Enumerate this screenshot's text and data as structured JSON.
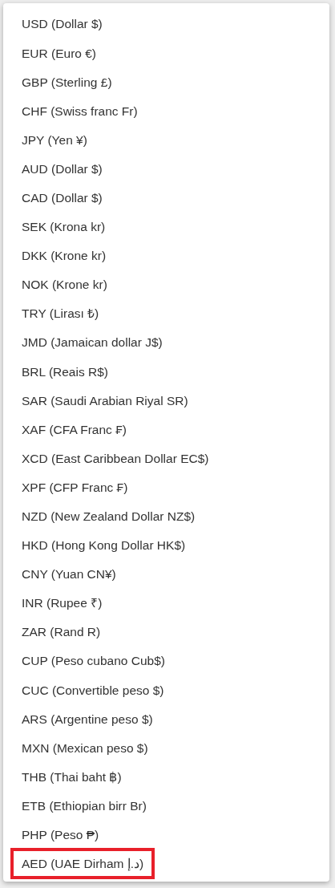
{
  "currencies": [
    {
      "label": "USD (Dollar $)",
      "highlighted": false
    },
    {
      "label": "EUR (Euro €)",
      "highlighted": false
    },
    {
      "label": "GBP (Sterling £)",
      "highlighted": false
    },
    {
      "label": "CHF (Swiss franc Fr)",
      "highlighted": false
    },
    {
      "label": "JPY (Yen ¥)",
      "highlighted": false
    },
    {
      "label": "AUD (Dollar $)",
      "highlighted": false
    },
    {
      "label": "CAD (Dollar $)",
      "highlighted": false
    },
    {
      "label": "SEK (Krona kr)",
      "highlighted": false
    },
    {
      "label": "DKK (Krone kr)",
      "highlighted": false
    },
    {
      "label": "NOK (Krone kr)",
      "highlighted": false
    },
    {
      "label": "TRY (Lirası ₺)",
      "highlighted": false
    },
    {
      "label": "JMD (Jamaican dollar J$)",
      "highlighted": false
    },
    {
      "label": "BRL (Reais R$)",
      "highlighted": false
    },
    {
      "label": "SAR (Saudi Arabian Riyal SR)",
      "highlighted": false
    },
    {
      "label": "XAF (CFA Franc ₣)",
      "highlighted": false
    },
    {
      "label": "XCD (East Caribbean Dollar EC$)",
      "highlighted": false
    },
    {
      "label": "XPF (CFP Franc ₣)",
      "highlighted": false
    },
    {
      "label": "NZD (New Zealand Dollar NZ$)",
      "highlighted": false
    },
    {
      "label": "HKD (Hong Kong Dollar HK$)",
      "highlighted": false
    },
    {
      "label": "CNY (Yuan CN¥)",
      "highlighted": false
    },
    {
      "label": "INR (Rupee ₹)",
      "highlighted": false
    },
    {
      "label": "ZAR (Rand R)",
      "highlighted": false
    },
    {
      "label": "CUP (Peso cubano Cub$)",
      "highlighted": false
    },
    {
      "label": "CUC (Convertible peso $)",
      "highlighted": false
    },
    {
      "label": "ARS (Argentine peso $)",
      "highlighted": false
    },
    {
      "label": "MXN (Mexican peso $)",
      "highlighted": false
    },
    {
      "label": "THB (Thai baht ฿)",
      "highlighted": false
    },
    {
      "label": "ETB (Ethiopian birr Br)",
      "highlighted": false
    },
    {
      "label": "PHP (Peso ₱)",
      "highlighted": false
    },
    {
      "label": "AED (UAE Dirham د.إ)",
      "highlighted": true
    }
  ]
}
